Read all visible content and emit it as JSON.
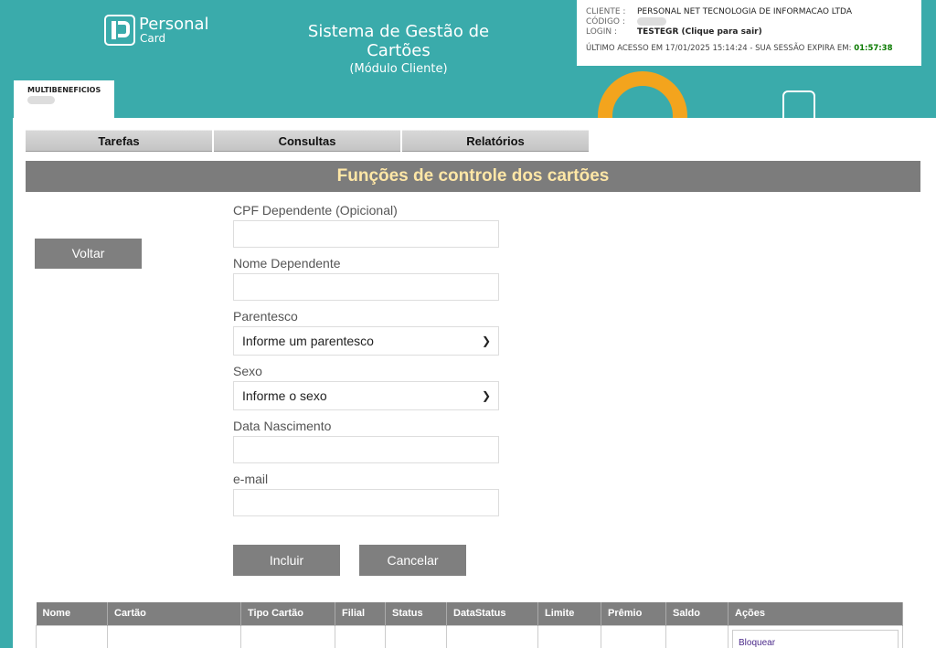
{
  "brand": {
    "name": "Personal",
    "sub": "Card"
  },
  "title": {
    "line1": "Sistema de Gestão de Cartões",
    "line2": "(Módulo Cliente)"
  },
  "session": {
    "cliente_label": "CLIENTE :",
    "cliente_value": "PERSONAL NET TECNOLOGIA DE INFORMACAO LTDA",
    "codigo_label": "CÓDIGO :",
    "login_label": "LOGIN :",
    "login_value": "TESTEGR (Clique para sair)",
    "last_access": "ÚLTIMO ACESSO EM 17/01/2025 15:14:24 -",
    "expires_label": "SUA SESSÃO EXPIRA EM:",
    "expires_value": "01:57:38"
  },
  "tab": {
    "label": "MULTIBENEFICIOS"
  },
  "menu": {
    "items": [
      {
        "label": "Tarefas"
      },
      {
        "label": "Consultas"
      },
      {
        "label": "Relatórios"
      }
    ]
  },
  "banner": {
    "title": "Funções de controle dos cartões"
  },
  "back_button": "Voltar",
  "form": {
    "cpf_label": "CPF Dependente (Opicional)",
    "nome_label": "Nome Dependente",
    "parentesco_label": "Parentesco",
    "parentesco_value": "Informe um parentesco",
    "sexo_label": "Sexo",
    "sexo_value": "Informe o sexo",
    "nascimento_label": "Data Nascimento",
    "email_label": "e-mail"
  },
  "buttons": {
    "incluir": "Incluir",
    "cancelar": "Cancelar"
  },
  "table": {
    "columns": [
      "Nome",
      "Cartão",
      "Tipo Cartão",
      "Filial",
      "Status",
      "DataStatus",
      "Limite",
      "Prêmio",
      "Saldo",
      "Ações"
    ],
    "row_action": "Bloquear"
  },
  "colors": {
    "background": "#3aabab",
    "accent": "#f3a41d",
    "banner_text": "#ffe7a6",
    "grey": "#7f7f7f"
  }
}
